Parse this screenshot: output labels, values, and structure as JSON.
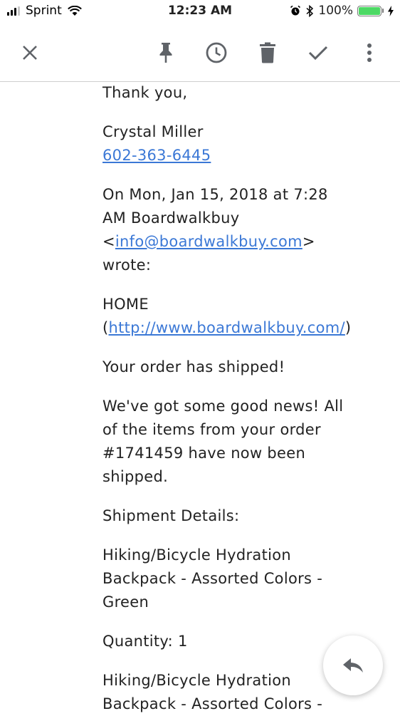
{
  "status_bar": {
    "carrier": "Sprint",
    "time": "12:23 AM",
    "battery_percent": "100%",
    "battery_level": 1.0,
    "signal_bars_filled": 3,
    "signal_bars_total": 4
  },
  "toolbar": {
    "icons": [
      "close-icon",
      "pin-icon",
      "clock-icon",
      "trash-icon",
      "check-icon",
      "more-vert-icon"
    ]
  },
  "message": {
    "closing": "Thank you,",
    "signature_name": "Crystal Miller",
    "signature_phone": "602-363-6445",
    "quote_intro_line1": "On Mon, Jan 15, 2018 at 7:28",
    "quote_intro_line2": "AM Boardwalkbuy",
    "quote_email": "info@boardwalkbuy.com",
    "quote_wrote": "wrote:",
    "home_label": "HOME",
    "home_url": "http://www.boardwalkbuy.com/",
    "headline": "Your order has shipped!",
    "news_line1": "We've got some good news! All",
    "news_line2": "of the items from your order",
    "news_line3": "#1741459 have now been",
    "news_line4": "shipped.",
    "shipment_heading": "Shipment Details:",
    "item1_line1": "Hiking/Bicycle Hydration",
    "item1_line2": "Backpack - Assorted Colors -",
    "item1_line3": "Green",
    "item1_quantity": "Quantity: 1",
    "item2_line1": "Hiking/Bicycle Hydration",
    "item2_line2": "Backpack - Assorted Colors -"
  },
  "colors": {
    "link": "#3b78d6",
    "battery": "#4cd964",
    "icon": "#5f6368"
  }
}
